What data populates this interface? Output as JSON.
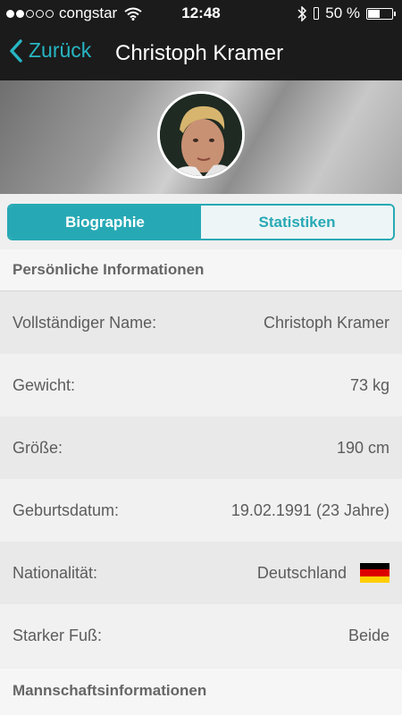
{
  "status_bar": {
    "carrier": "congstar",
    "time": "12:48",
    "battery_percent": "50 %",
    "battery_level": 0.5,
    "signal_bars": 2,
    "signal_total": 5
  },
  "nav": {
    "back_label": "Zurück",
    "title": "Christoph Kramer"
  },
  "tabs": [
    {
      "label": "Biographie",
      "active": true
    },
    {
      "label": "Statistiken",
      "active": false
    }
  ],
  "sections": {
    "personal": "Persönliche Informationen",
    "team": "Mannschaftsinformationen"
  },
  "rows": [
    {
      "label": "Vollständiger Name:",
      "value": "Christoph Kramer"
    },
    {
      "label": "Gewicht:",
      "value": "73 kg"
    },
    {
      "label": "Größe:",
      "value": "190 cm"
    },
    {
      "label": "Geburtsdatum:",
      "value": "19.02.1991 (23 Jahre)"
    },
    {
      "label": "Nationalität:",
      "value": "Deutschland",
      "icon": "germany-flag-icon"
    },
    {
      "label": "Starker Fuß:",
      "value": "Beide"
    }
  ],
  "colors": {
    "accent": "#27a9b5",
    "nav_background": "#1b1b1b",
    "flag_black": "#000000",
    "flag_red": "#dd0000",
    "flag_gold": "#ffce00"
  }
}
